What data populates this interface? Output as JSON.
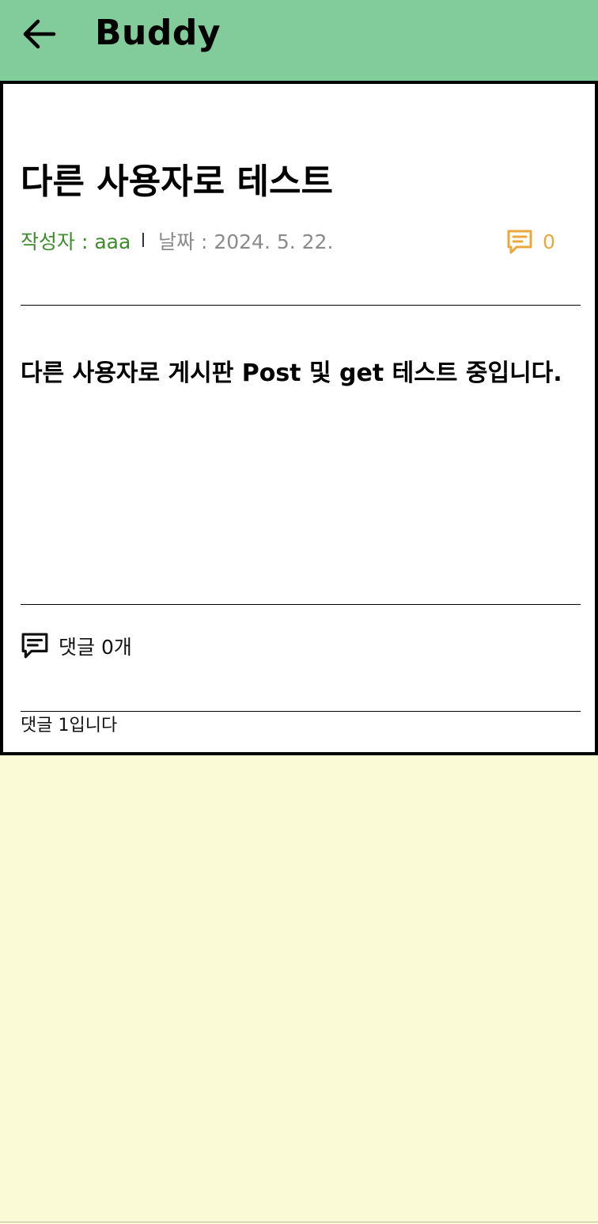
{
  "appbar": {
    "title": "Buddy",
    "back_icon": "arrow-left-icon"
  },
  "post": {
    "title": "다른 사용자로 테스트",
    "author": "작성자 : aaa",
    "date": "날짜 : 2024. 5. 22.",
    "comment_count": "0",
    "comment_icon": "comment-icon",
    "body": "다른 사용자로 게시판 Post 및 get 테스트 중입니다."
  },
  "comments": {
    "summary": "댓글 0개",
    "items": [
      {
        "text": "댓글 1입니다"
      }
    ]
  },
  "colors": {
    "appbar_bg": "#82cb9a",
    "page_bg": "#fafad6",
    "author": "#3e8c2c",
    "date": "#8a8a8a",
    "comment_accent": "#e8a93a"
  }
}
